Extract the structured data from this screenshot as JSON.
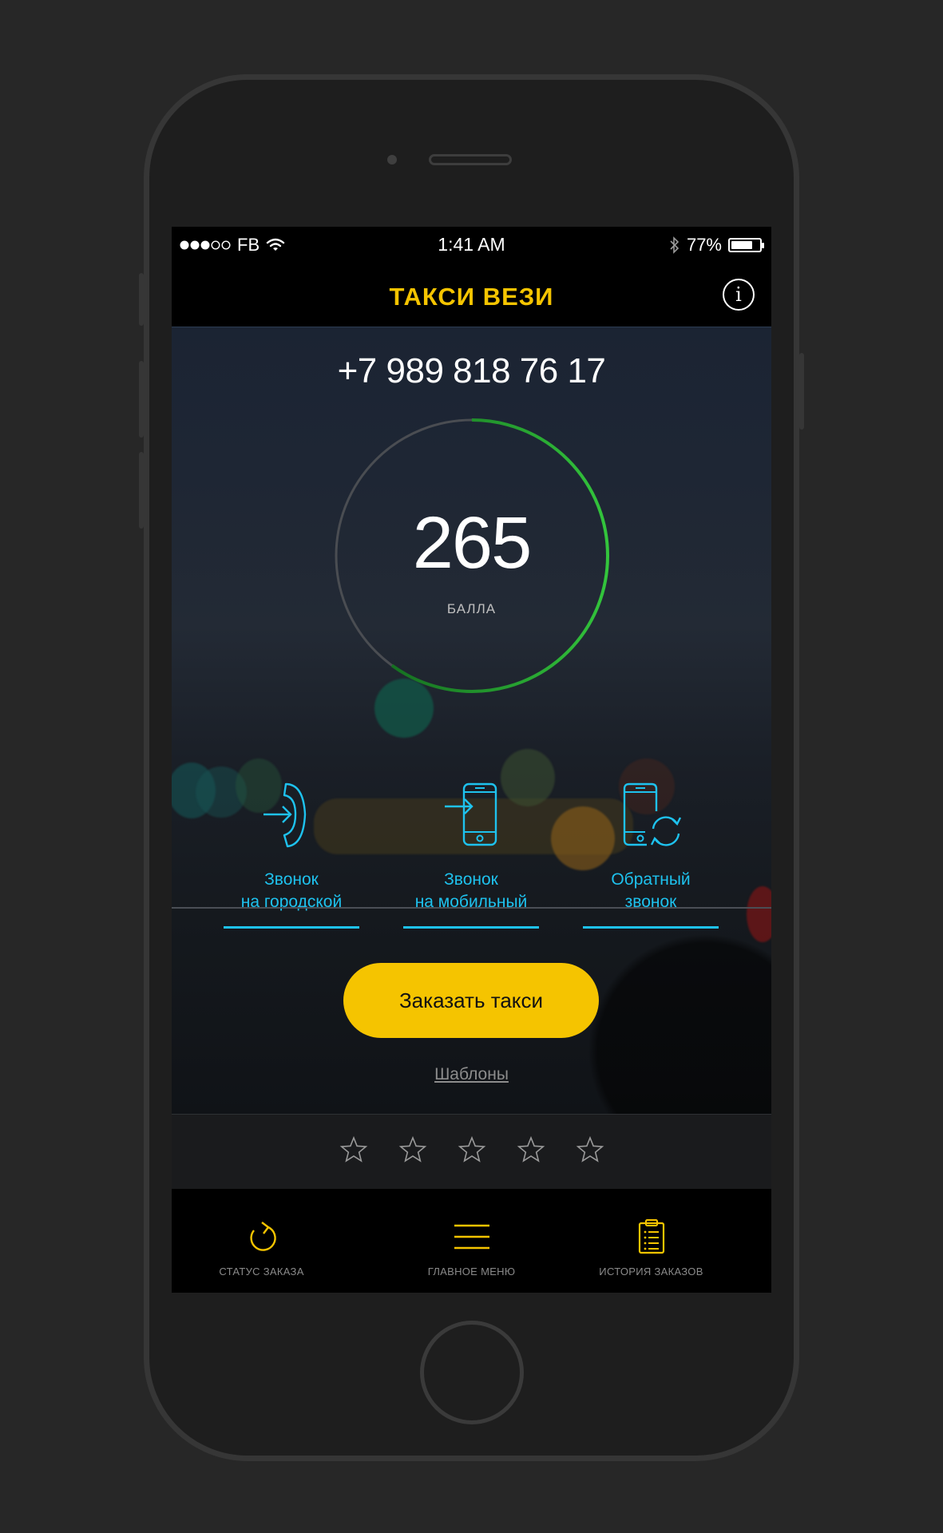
{
  "status_bar": {
    "carrier": "FB",
    "time": "1:41 AM",
    "battery_percent": "77%",
    "battery_level": 0.77,
    "signal_dots_filled": 3,
    "signal_dots_total": 5
  },
  "header": {
    "title": "ТАКСИ ВЕЗИ",
    "info_icon": "info-icon",
    "title_color": "#f5c400"
  },
  "profile": {
    "phone": "+7 989 818 76 17",
    "points": "265",
    "points_label": "БАЛЛА",
    "progress_fraction": 0.6,
    "progress_color": "#2fbf3a"
  },
  "call_options": [
    {
      "line1": "Звонок",
      "line2": "на городской",
      "icon": "landline-call-icon"
    },
    {
      "line1": "Звонок",
      "line2": "на мобильный",
      "icon": "mobile-call-icon"
    },
    {
      "line1": "Обратный",
      "line2": "звонок",
      "icon": "callback-icon"
    }
  ],
  "order_button": {
    "label": "Заказать такси",
    "color": "#f5c400"
  },
  "templates_link": "Шаблоны",
  "rating": {
    "stars_total": 5,
    "stars_filled": 0
  },
  "tab_bar": [
    {
      "label": "СТАТУС ЗАКАЗА",
      "icon": "refresh-icon"
    },
    {
      "label": "ГЛАВНОЕ МЕНЮ",
      "icon": "menu-icon"
    },
    {
      "label": "ИСТОРИЯ ЗАКАЗОВ",
      "icon": "clipboard-list-icon"
    }
  ],
  "accent_cyan": "#1ec2ee"
}
